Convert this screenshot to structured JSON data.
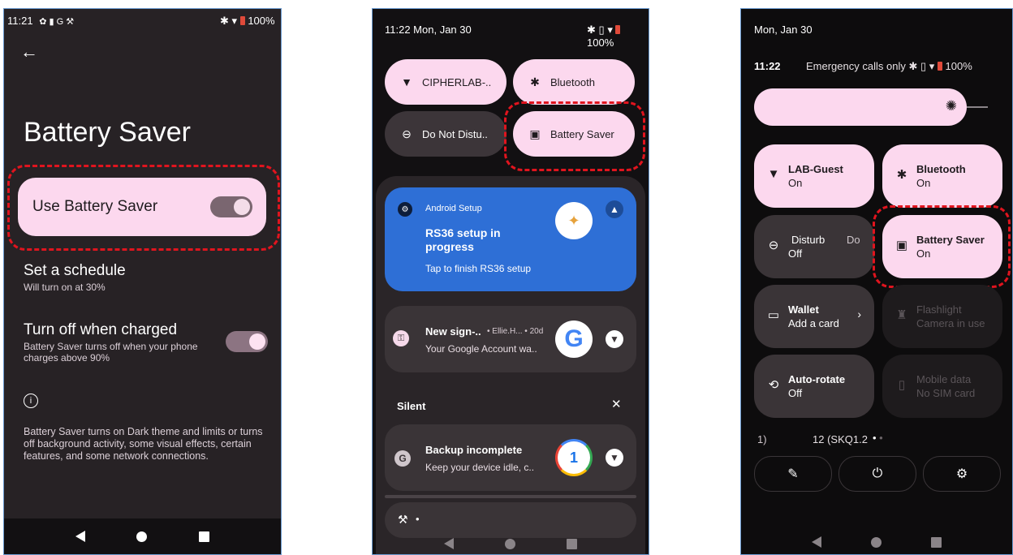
{
  "phone1": {
    "status": {
      "time": "11:21",
      "glyphs": "✿ ▮ G ⚒",
      "battery": "100%"
    },
    "title": "Battery Saver",
    "use_saver": {
      "label": "Use Battery Saver",
      "enabled": true
    },
    "schedule": {
      "title": "Set a schedule",
      "subtitle": "Will turn on at 30%"
    },
    "turn_off": {
      "title": "Turn off when charged",
      "subtitle": "Battery Saver turns off when your phone charges above 90%",
      "enabled": true
    },
    "footer": "Battery Saver turns on Dark theme and limits or turns off background activity, some visual effects, certain features, and some network connections."
  },
  "phone2": {
    "status": {
      "time": "11:22 Mon, Jan 30",
      "battery": "100%"
    },
    "tiles": {
      "wifi": "CIPHERLAB-..",
      "bluetooth": "Bluetooth",
      "dnd": "Do Not Distu..",
      "battery_saver": "Battery Saver"
    },
    "setup_notif": {
      "app": "Android Setup",
      "title": "RS36 setup in progress",
      "body": "Tap to finish RS36 setup"
    },
    "signin_notif": {
      "title": "New sign-..",
      "meta": "• Ellie.H... • 20d",
      "body": "Your Google Account wa.."
    },
    "silent_header": "Silent",
    "backup_notif": {
      "title": "Backup incomplete",
      "body": "Keep your device idle, c.."
    },
    "bottom_bar": "•"
  },
  "phone3": {
    "date": "Mon, Jan 30",
    "time": "11:22",
    "emergency": "Emergency calls only",
    "battery": "100%",
    "tiles": {
      "wifi": {
        "title": "LAB-Guest",
        "sub": "On"
      },
      "bluetooth": {
        "title": "Bluetooth",
        "sub": "On"
      },
      "dnd": {
        "title": "Disturb",
        "sub": "Off",
        "extra": "Do"
      },
      "battery_saver": {
        "title": "Battery Saver",
        "sub": "On"
      },
      "wallet": {
        "title": "Wallet",
        "sub": "Add a card"
      },
      "flashlight": {
        "title": "Flashlight",
        "sub": "Camera in use"
      },
      "autorotate": {
        "title": "Auto-rotate",
        "sub": "Off"
      },
      "mobile_data": {
        "title": "Mobile data",
        "sub": "No SIM card"
      }
    },
    "build_left": "1)",
    "build_text": "12 (SKQ1.2"
  },
  "colors": {
    "accent_pink": "#fcd8ee",
    "highlight_red": "#e0141e",
    "setup_blue": "#2e6fd6"
  }
}
